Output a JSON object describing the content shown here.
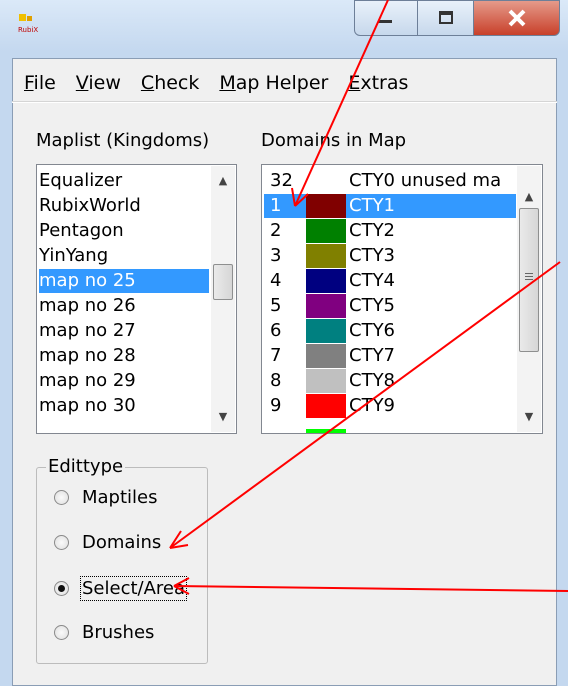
{
  "window": {
    "logo_text": "RubiX",
    "accent_close": "#c8402a"
  },
  "menu": {
    "items": [
      {
        "label": "File",
        "accel": "F",
        "rest": "ile"
      },
      {
        "label": "View",
        "accel": "V",
        "rest": "iew"
      },
      {
        "label": "Check",
        "accel": "C",
        "rest": "heck"
      },
      {
        "label": "Map Helper",
        "accel": "M",
        "rest": "ap Helper"
      },
      {
        "label": "Extras",
        "accel": "E",
        "rest": "xtras"
      }
    ]
  },
  "maplist": {
    "label": "Maplist (Kingdoms)",
    "items": [
      "Equalizer",
      "RubixWorld",
      "Pentagon",
      "YinYang",
      "map no 25",
      "map no 26",
      "map no 27",
      "map no 28",
      "map no 29",
      "map no 30"
    ],
    "selected_index": 4
  },
  "domains": {
    "label": "Domains in Map",
    "rows": [
      {
        "num": "32",
        "color": "",
        "name": "CTY0 unused ma"
      },
      {
        "num": "1",
        "color": "#800000",
        "name": "CTY1",
        "selected": true
      },
      {
        "num": "2",
        "color": "#008000",
        "name": "CTY2"
      },
      {
        "num": "3",
        "color": "#808000",
        "name": "CTY3"
      },
      {
        "num": "4",
        "color": "#000080",
        "name": "CTY4"
      },
      {
        "num": "5",
        "color": "#800080",
        "name": "CTY5"
      },
      {
        "num": "6",
        "color": "#008080",
        "name": "CTY6"
      },
      {
        "num": "7",
        "color": "#808080",
        "name": "CTY7"
      },
      {
        "num": "8",
        "color": "#c0c0c0",
        "name": "CTY8"
      },
      {
        "num": "9",
        "color": "#ff0000",
        "name": "CTY9"
      }
    ]
  },
  "edittype": {
    "title": "Edittype",
    "options": [
      {
        "label": "Maptiles",
        "checked": false
      },
      {
        "label": "Domains",
        "checked": false
      },
      {
        "label": "Select/Area",
        "checked": true
      },
      {
        "label": "Brushes",
        "checked": false
      }
    ]
  },
  "annotation_color": "#ff0000"
}
